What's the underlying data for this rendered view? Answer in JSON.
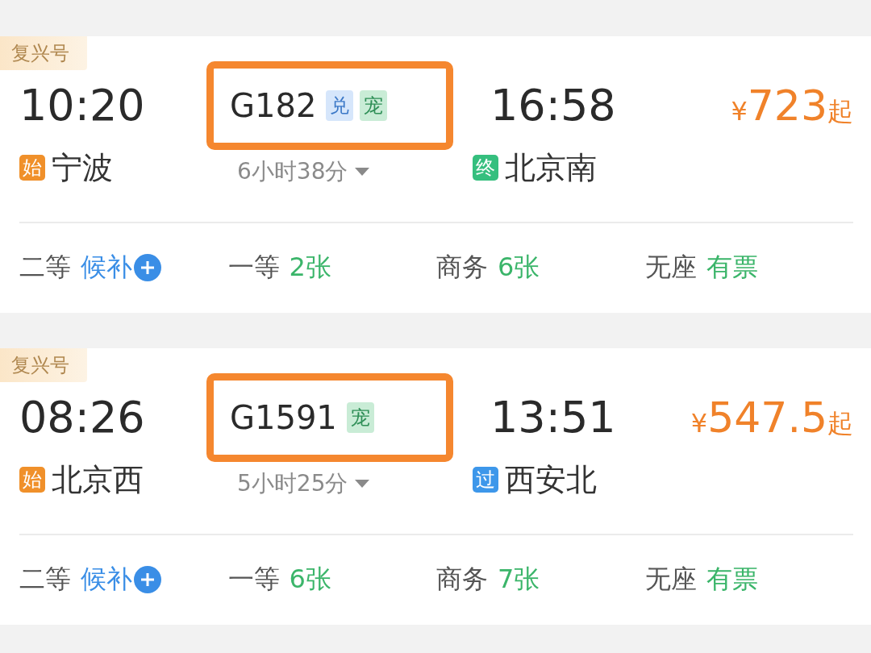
{
  "trains": [
    {
      "badge": "复兴号",
      "depart_time": "10:20",
      "train_number": "G182",
      "tags": [
        {
          "label": "兑",
          "kind": "exchange"
        },
        {
          "label": "宠",
          "kind": "pet"
        }
      ],
      "arrive_time": "16:58",
      "price": {
        "currency": "¥",
        "amount": "723",
        "suffix": "起"
      },
      "from": {
        "mark": "始",
        "kind": "start",
        "name": "宁波"
      },
      "duration": "6小时38分",
      "to": {
        "mark": "终",
        "kind": "end",
        "name": "北京南"
      },
      "seats": [
        {
          "class": "二等",
          "availability": "候补",
          "kind": "waitlist"
        },
        {
          "class": "一等",
          "availability": "2张",
          "kind": "available"
        },
        {
          "class": "商务",
          "availability": "6张",
          "kind": "available"
        },
        {
          "class": "无座",
          "availability": "有票",
          "kind": "available"
        }
      ]
    },
    {
      "badge": "复兴号",
      "depart_time": "08:26",
      "train_number": "G1591",
      "tags": [
        {
          "label": "宠",
          "kind": "pet"
        }
      ],
      "arrive_time": "13:51",
      "price": {
        "currency": "¥",
        "amount": "547.5",
        "suffix": "起"
      },
      "from": {
        "mark": "始",
        "kind": "start",
        "name": "北京西"
      },
      "duration": "5小时25分",
      "to": {
        "mark": "过",
        "kind": "pass",
        "name": "西安北"
      },
      "seats": [
        {
          "class": "二等",
          "availability": "候补",
          "kind": "waitlist"
        },
        {
          "class": "一等",
          "availability": "6张",
          "kind": "available"
        },
        {
          "class": "商务",
          "availability": "7张",
          "kind": "available"
        },
        {
          "class": "无座",
          "availability": "有票",
          "kind": "available"
        }
      ]
    }
  ]
}
